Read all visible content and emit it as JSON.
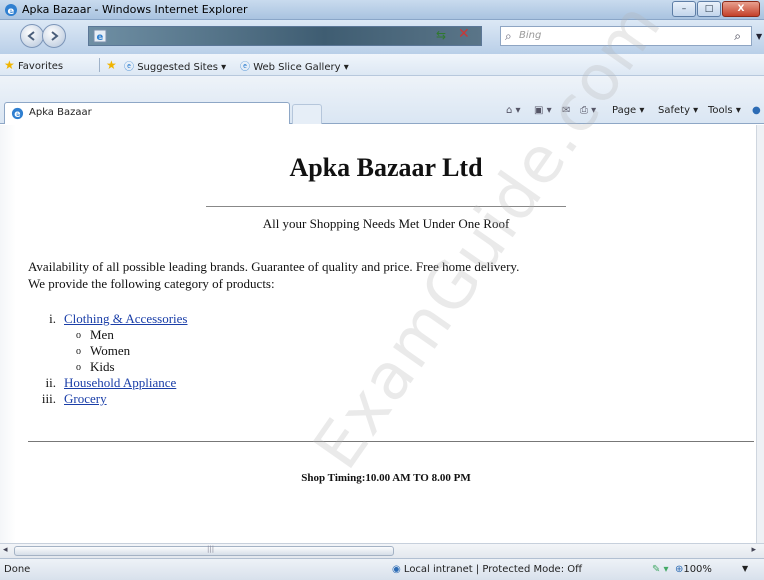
{
  "window": {
    "title": "Apka Bazaar - Windows Internet Explorer",
    "minimize": "–",
    "maximize": "□",
    "close": "X"
  },
  "navbar": {
    "search_placeholder": "Bing"
  },
  "favorites_bar": {
    "favorites": "Favorites",
    "suggested_sites": "Suggested Sites ▾",
    "web_slice_gallery": "Web Slice Gallery ▾"
  },
  "tab": {
    "label": "Apka Bazaar"
  },
  "command_bar": {
    "page": "Page ▾",
    "safety": "Safety ▾",
    "tools": "Tools ▾"
  },
  "page": {
    "heading": "Apka Bazaar Ltd",
    "tagline": "All your Shopping Needs Met Under One Roof",
    "intro_line1": "Availability of all possible leading brands. Guarantee of quality and price. Free home delivery.",
    "intro_line2": "We provide the following category of products:",
    "categories": [
      {
        "num": "i.",
        "label": "Clothing & Accessories",
        "sub": [
          "Men",
          "Women",
          "Kids"
        ]
      },
      {
        "num": "ii.",
        "label": "Household Appliance"
      },
      {
        "num": "iii.",
        "label": "Grocery"
      }
    ],
    "timing": "Shop Timing:10.00 AM TO 8.00 PM"
  },
  "watermark": "ExamGuide.com",
  "status_bar": {
    "status": "Done",
    "zone": "Local intranet | Protected Mode: Off",
    "zoom": "100%"
  },
  "colors": {
    "link": "#1a3ea8",
    "titlebar": "#a9c3e0",
    "close_button": "#c4412a"
  }
}
